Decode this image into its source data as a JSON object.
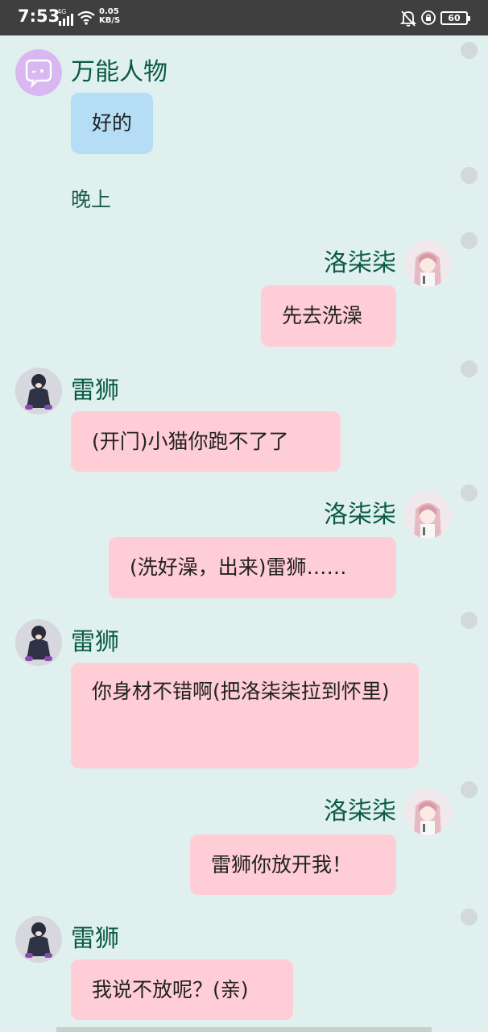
{
  "status_bar": {
    "time": "7:53",
    "network": "4G",
    "speed_value": "0.05",
    "speed_unit": "KB/S",
    "battery": "60"
  },
  "messages": [
    {
      "sender": "万能人物",
      "text": "好的",
      "side": "left"
    },
    {
      "text": "晚上",
      "side": "left"
    },
    {
      "sender": "洛柒柒",
      "text": "先去洗澡",
      "side": "right"
    },
    {
      "sender": "雷狮",
      "text": "(开门)小猫你跑不了了",
      "side": "left"
    },
    {
      "sender": "洛柒柒",
      "text": "(洗好澡，出来)雷狮……",
      "side": "right"
    },
    {
      "sender": "雷狮",
      "text": "你身材不错啊(把洛柒柒拉到怀里)",
      "side": "left"
    },
    {
      "sender": "洛柒柒",
      "text": "雷狮你放开我！",
      "side": "right"
    },
    {
      "sender": "雷狮",
      "text": "我说不放呢？(亲)",
      "side": "left"
    }
  ],
  "colors": {
    "background": "#dff0ef",
    "bubble_pink": "#ffcdd6",
    "bubble_blue": "#b5def6",
    "name_green": "#0b5a45"
  }
}
